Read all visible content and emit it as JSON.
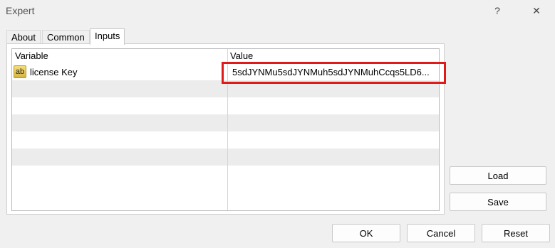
{
  "window": {
    "title": "Expert",
    "help_label": "?",
    "close_label": "✕"
  },
  "tabs": [
    {
      "label": "About"
    },
    {
      "label": "Common"
    },
    {
      "label": "Inputs"
    }
  ],
  "grid": {
    "headers": {
      "variable": "Variable",
      "value": "Value"
    },
    "rows": [
      {
        "variable": "license Key",
        "icon": "ab",
        "value": "5sdJYNMu5sdJYNMuh5sdJYNMuhCcqs5LD6..."
      }
    ]
  },
  "side_buttons": {
    "load": "Load",
    "save": "Save"
  },
  "footer_buttons": {
    "ok": "OK",
    "cancel": "Cancel",
    "reset": "Reset"
  },
  "colors": {
    "highlight": "#e01919"
  }
}
